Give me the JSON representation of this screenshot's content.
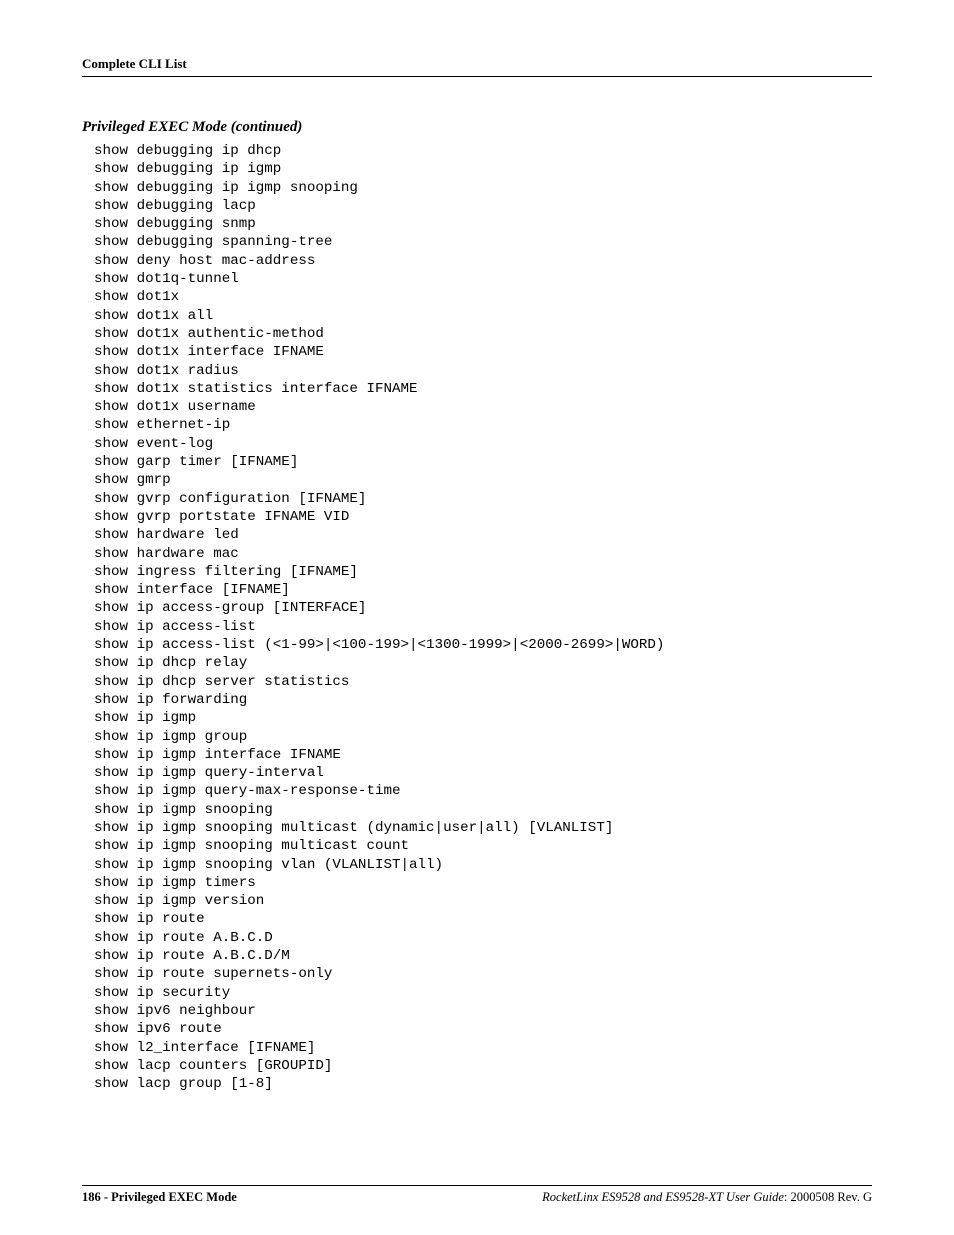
{
  "header": {
    "title": "Complete CLI List"
  },
  "section": {
    "title": "Privileged EXEC Mode (continued)"
  },
  "cli_lines": [
    "show debugging ip dhcp",
    "show debugging ip igmp",
    "show debugging ip igmp snooping",
    "show debugging lacp",
    "show debugging snmp",
    "show debugging spanning-tree",
    "show deny host mac-address",
    "show dot1q-tunnel",
    "show dot1x",
    "show dot1x all",
    "show dot1x authentic-method",
    "show dot1x interface IFNAME",
    "show dot1x radius",
    "show dot1x statistics interface IFNAME",
    "show dot1x username",
    "show ethernet-ip",
    "show event-log",
    "show garp timer [IFNAME]",
    "show gmrp",
    "show gvrp configuration [IFNAME]",
    "show gvrp portstate IFNAME VID",
    "show hardware led",
    "show hardware mac",
    "show ingress filtering [IFNAME]",
    "show interface [IFNAME]",
    "show ip access-group [INTERFACE]",
    "show ip access-list",
    "show ip access-list (<1-99>|<100-199>|<1300-1999>|<2000-2699>|WORD)",
    "show ip dhcp relay",
    "show ip dhcp server statistics",
    "show ip forwarding",
    "show ip igmp",
    "show ip igmp group",
    "show ip igmp interface IFNAME",
    "show ip igmp query-interval",
    "show ip igmp query-max-response-time",
    "show ip igmp snooping",
    "show ip igmp snooping multicast (dynamic|user|all) [VLANLIST]",
    "show ip igmp snooping multicast count",
    "show ip igmp snooping vlan (VLANLIST|all)",
    "show ip igmp timers",
    "show ip igmp version",
    "show ip route",
    "show ip route A.B.C.D",
    "show ip route A.B.C.D/M",
    "show ip route supernets-only",
    "show ip security",
    "show ipv6 neighbour",
    "show ipv6 route",
    "show l2_interface [IFNAME]",
    "show lacp counters [GROUPID]",
    "show lacp group [1-8]"
  ],
  "footer": {
    "page_number": "186",
    "section_name": "Privileged EXEC Mode",
    "guide_title": "RocketLinx ES9528 and ES9528-XT User Guide",
    "doc_id": "2000508 Rev. G"
  }
}
